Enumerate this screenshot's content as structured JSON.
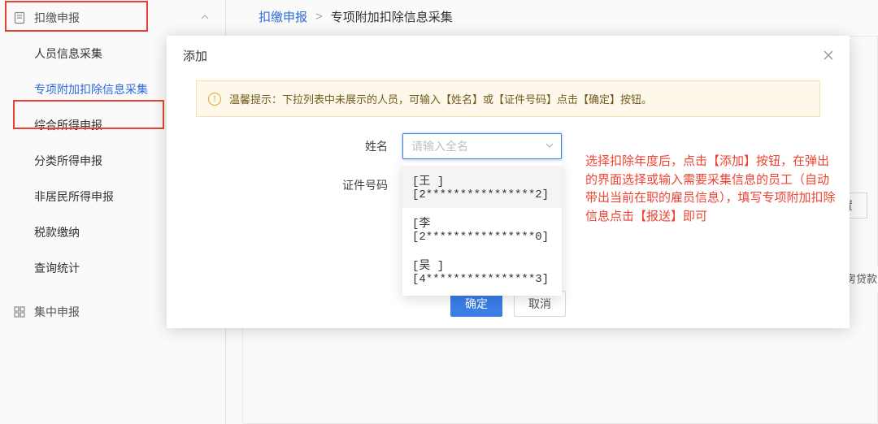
{
  "sidebar": {
    "group1": {
      "title": "扣缴申报",
      "items": [
        {
          "label": "人员信息采集"
        },
        {
          "label": "专项附加扣除信息采集"
        },
        {
          "label": "综合所得申报"
        },
        {
          "label": "分类所得申报"
        },
        {
          "label": "非居民所得申报"
        },
        {
          "label": "税款缴纳"
        },
        {
          "label": "查询统计"
        }
      ]
    },
    "group2": {
      "title": "集中申报"
    }
  },
  "breadcrumb": {
    "link": "扣缴申报",
    "current": "专项附加扣除信息采集"
  },
  "background": {
    "reset_label": "重置",
    "tag_label": "住房贷款"
  },
  "modal": {
    "title": "添加",
    "tip_prefix": "温馨提示：",
    "tip_body": "下拉列表中未展示的人员，可输入【姓名】或【证件号码】点击【确定】按钮。",
    "field_name_label": "姓名",
    "field_name_placeholder": "请输入全名",
    "field_id_label": "证件号码",
    "dropdown": [
      "[王     ][2****************2]",
      "[李    [2****************0]",
      "[吴     ][4****************3]"
    ],
    "ok_label": "确定",
    "cancel_label": "取消"
  },
  "annotation": {
    "text": "选择扣除年度后，点击【添加】按钮，在弹出的界面选择或输入需要采集信息的员工（自动带出当前在职的雇员信息），填写专项附加扣除信息点击【报送】即可"
  }
}
